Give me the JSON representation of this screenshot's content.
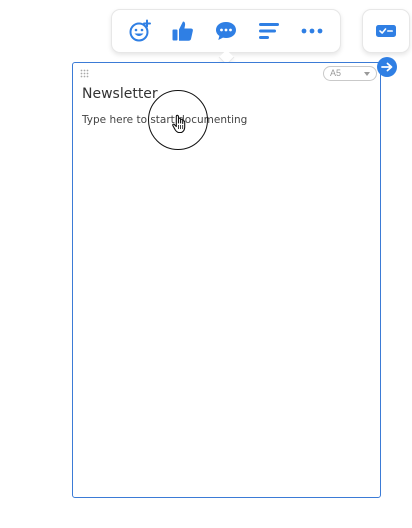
{
  "toolbar": {
    "buttons": [
      {
        "name": "add-emoji",
        "icon": "emoji-plus-icon"
      },
      {
        "name": "like",
        "icon": "thumbs-up-icon"
      },
      {
        "name": "comment",
        "icon": "chat-bubble-icon"
      },
      {
        "name": "text-align",
        "icon": "align-left-icon"
      },
      {
        "name": "more",
        "icon": "more-dots-icon"
      }
    ]
  },
  "side_panel": {
    "icon": "checklist-card-icon"
  },
  "page": {
    "size_label": "A5",
    "title": "Newsletter",
    "body_placeholder": "Type here to start documenting"
  },
  "colors": {
    "accent": "#2f7fe4",
    "page_border": "#3b7bd6",
    "text": "#333333"
  }
}
